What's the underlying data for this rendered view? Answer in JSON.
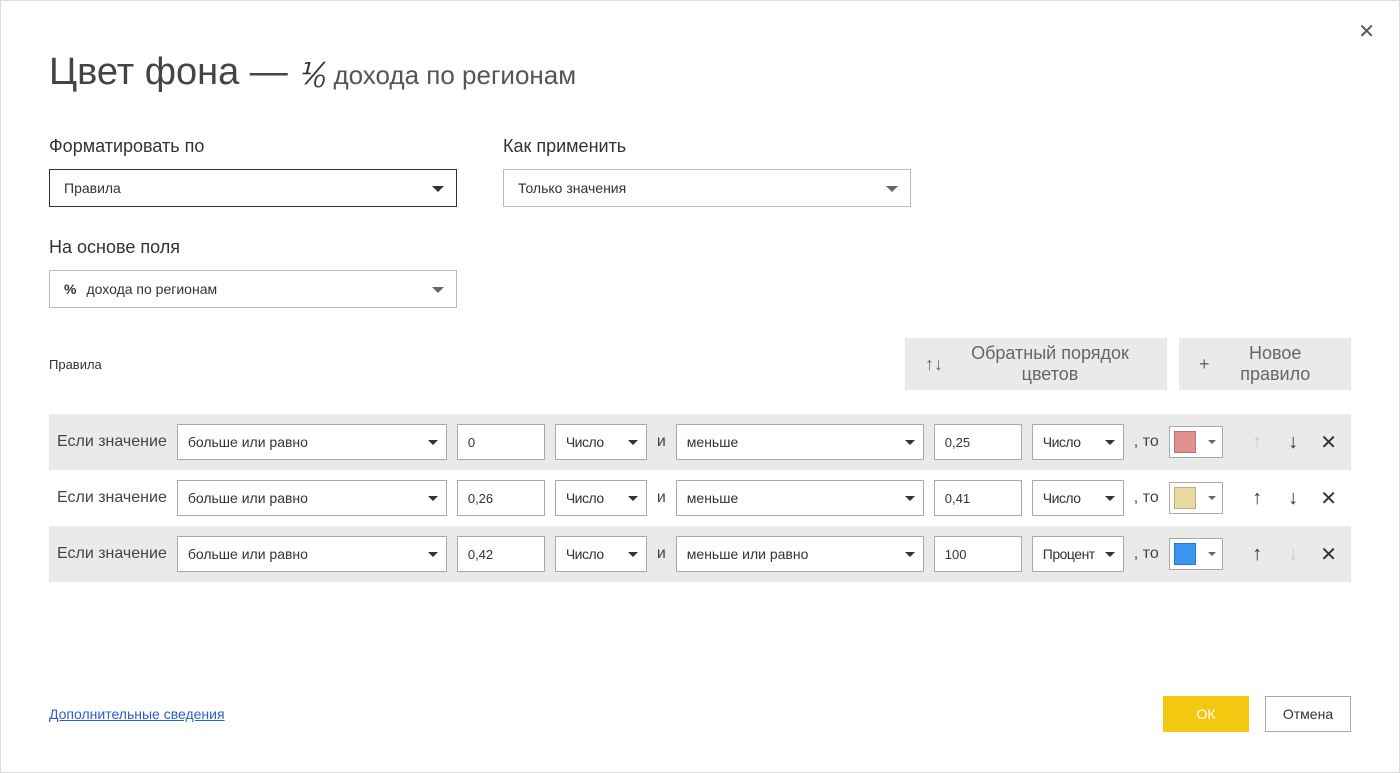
{
  "title": {
    "main": "Цвет фона —",
    "sub": "дохода по регионам"
  },
  "labels": {
    "format_by": "Форматировать по",
    "apply_to": "Как применить",
    "based_on": "На основе поля",
    "rules": "Правила"
  },
  "selects": {
    "format_by_value": "Правила",
    "apply_to_value": "Только значения",
    "based_on_value": "дохода по регионам"
  },
  "actions": {
    "reverse_colors": "Обратный порядок цветов",
    "reverse_prefix": "↑↓",
    "new_rule": "Новое правило"
  },
  "rule_text": {
    "if_value": "Если значение",
    "and": "и",
    "then": ", то"
  },
  "rules": [
    {
      "op1": "больше или равно",
      "val1": "0",
      "type1": "Число",
      "op2": "меньше",
      "val2": "0,25",
      "type2": "Число",
      "color": "#e29191",
      "up_disabled": true,
      "down_disabled": false
    },
    {
      "op1": "больше или равно",
      "val1": "0,26",
      "type1": "Число",
      "op2": "меньше",
      "val2": "0,41",
      "type2": "Число",
      "color": "#e8daa2",
      "up_disabled": false,
      "down_disabled": false
    },
    {
      "op1": "больше или равно",
      "val1": "0,42",
      "type1": "Число",
      "op2": "меньше или равно",
      "val2": "100",
      "type2": "Процент",
      "color": "#3a96f0",
      "up_disabled": false,
      "down_disabled": true
    }
  ],
  "footer": {
    "learn_more": "Дополнительные сведения",
    "ok": "ОК",
    "cancel": "Отмена"
  }
}
